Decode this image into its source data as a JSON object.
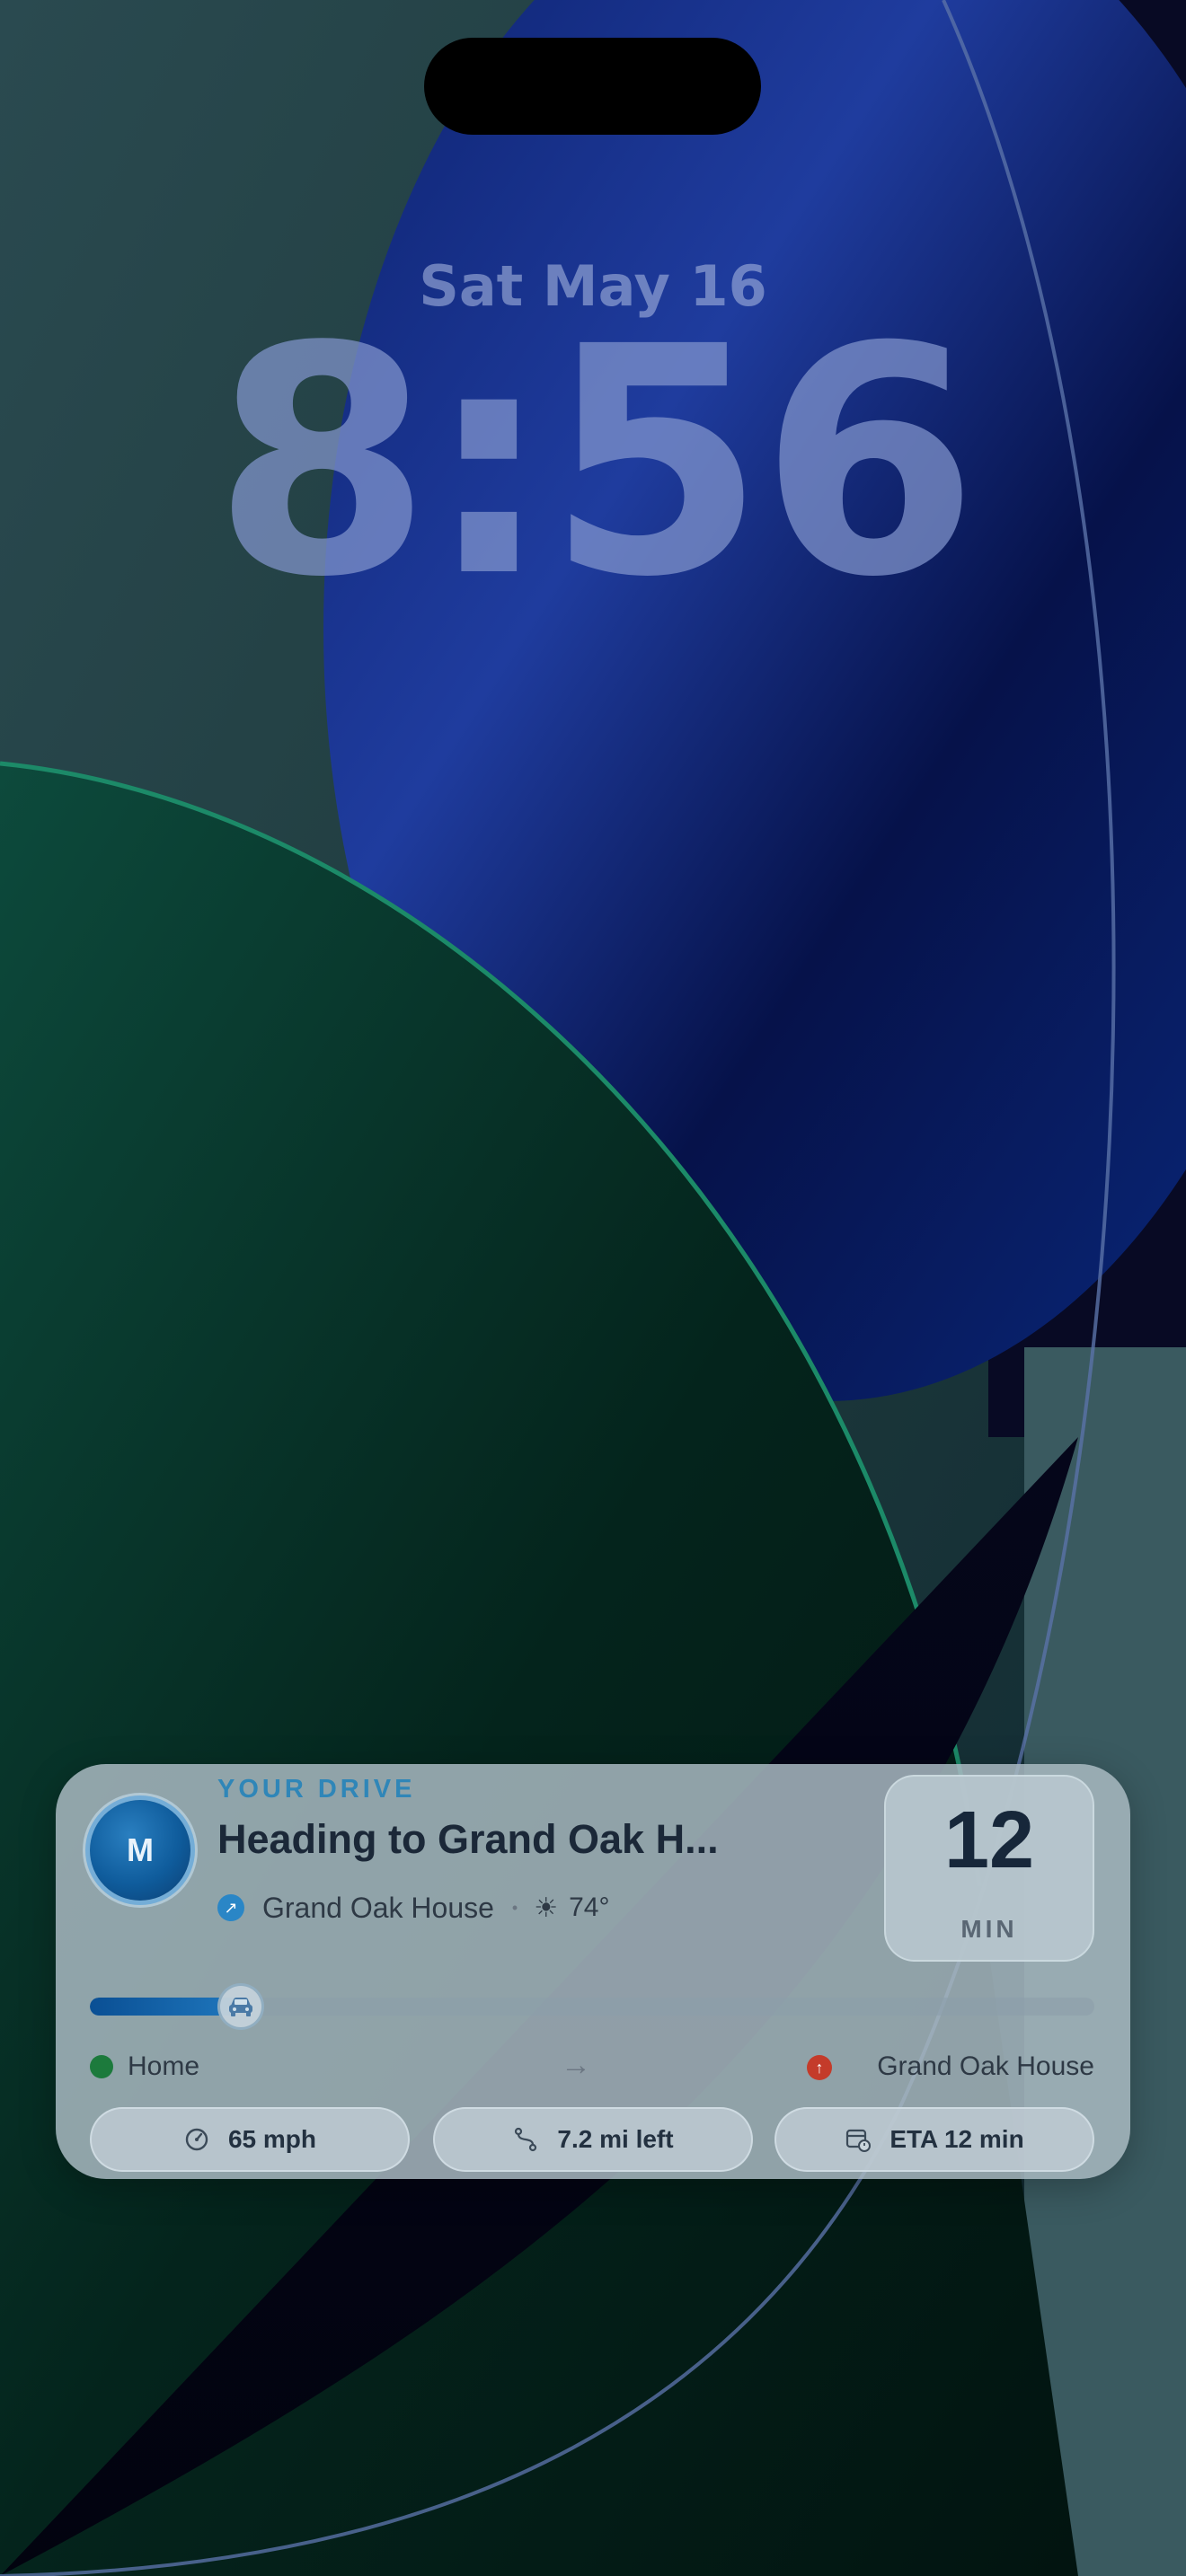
{
  "lock_screen": {
    "date": "Sat May 16",
    "time": "8:56"
  },
  "live_activity": {
    "avatar_initial": "M",
    "eyebrow": "YOUR DRIVE",
    "title": "Heading to Grand Oak H...",
    "destination": "Grand Oak House",
    "separator": "•",
    "weather_icon": "sun-icon",
    "temperature": "74°",
    "minutes": "12",
    "minutes_unit": "MIN",
    "progress": 0.15,
    "origin": "Home",
    "route_arrow": "→",
    "end_label": "Grand Oak House",
    "chips": [
      {
        "icon": "speedometer-icon",
        "label": "65 mph"
      },
      {
        "icon": "route-icon",
        "label": "7.2 mi left"
      },
      {
        "icon": "calendar-clock-icon",
        "label": "ETA 12 min"
      }
    ],
    "colors": {
      "accent": "#2f86b8",
      "progress_fill": "#0a4f94",
      "origin": "#1c7a3c",
      "destination": "#c43b2a"
    }
  }
}
